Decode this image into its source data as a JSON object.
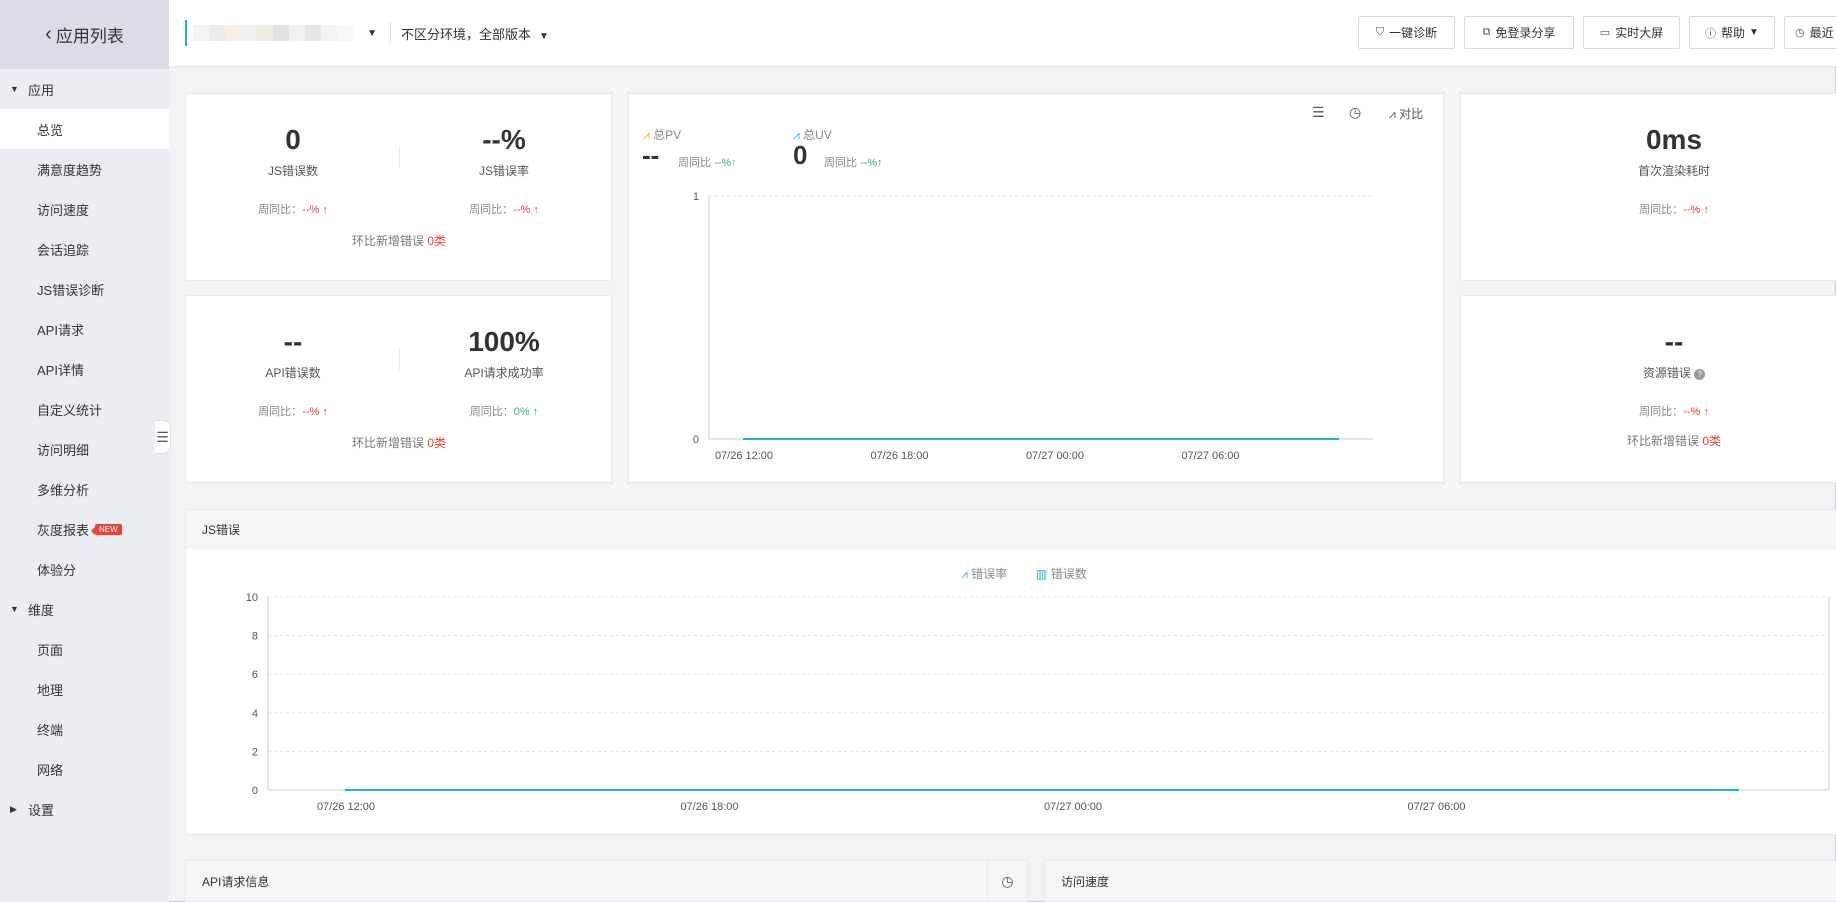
{
  "sidebar": {
    "back_label": "应用列表",
    "groups": [
      {
        "label": "应用",
        "expanded": true,
        "items": [
          "总览",
          "满意度趋势",
          "访问速度",
          "会话追踪",
          "JS错误诊断",
          "API请求",
          "API详情",
          "自定义统计",
          "访问明细",
          "多维分析",
          "灰度报表",
          "体验分"
        ]
      },
      {
        "label": "维度",
        "expanded": true,
        "items": [
          "页面",
          "地理",
          "终端",
          "网络"
        ]
      },
      {
        "label": "设置",
        "expanded": false,
        "items": []
      }
    ],
    "active_item": "总览",
    "new_badge": "NEW"
  },
  "header": {
    "env_label": "不区分环境，全部版本",
    "buttons": {
      "diagnose": "一键诊断",
      "share": "免登录分享",
      "bigscreen": "实时大屏",
      "help": "帮助",
      "recent": "最近"
    }
  },
  "cards": {
    "js_error_count": {
      "value": "0",
      "label": "JS错误数",
      "cmp_label": "周同比：",
      "cmp_value": "--%"
    },
    "js_error_rate": {
      "value": "--%",
      "label": "JS错误率",
      "cmp_label": "周同比：",
      "cmp_value": "--%"
    },
    "js_new_errors": {
      "label": "环比新增错误",
      "value": "0类"
    },
    "api_error_count": {
      "value": "--",
      "label": "API错误数",
      "cmp_label": "周同比：",
      "cmp_value": "--%"
    },
    "api_success_rate": {
      "value": "100%",
      "label": "API请求成功率",
      "cmp_label": "周同比：",
      "cmp_value": "0%"
    },
    "api_new_errors": {
      "label": "环比新增错误",
      "value": "0类"
    },
    "first_render": {
      "value": "0ms",
      "label": "首次渲染耗时",
      "cmp_label": "周同比：",
      "cmp_value": "--%"
    },
    "resource_error": {
      "value": "--",
      "label": "资源错误",
      "cmp_label": "周同比：",
      "cmp_value": "--%",
      "new_label": "环比新增错误",
      "new_value": "0类"
    }
  },
  "pvuv": {
    "pv_label": "总PV",
    "pv_value": "--",
    "pv_cmp_label": "周同比",
    "pv_cmp_value": "--%",
    "uv_label": "总UV",
    "uv_value": "0",
    "uv_cmp_label": "周同比",
    "uv_cmp_value": "--%",
    "compare_label": "对比"
  },
  "js_panel": {
    "title": "JS错误",
    "legend_rate": "错误率",
    "legend_count": "错误数"
  },
  "api_panel": {
    "title": "API请求信息"
  },
  "speed_panel": {
    "title": "访问速度"
  },
  "colors": {
    "accent": "#1fb6c1",
    "red": "#f04134",
    "green": "#2fb87a",
    "pv": "#f5b400",
    "uv": "#3eb3d6"
  },
  "chart_data": [
    {
      "type": "line",
      "x": [
        "07/26 12:00",
        "07/26 18:00",
        "07/27 00:00",
        "07/27 06:00"
      ],
      "y_ticks": [
        "0",
        "1"
      ],
      "ylim": [
        0,
        1
      ],
      "series": [
        {
          "name": "总UV",
          "values": [
            0,
            0,
            0,
            0
          ]
        }
      ],
      "grid": true
    },
    {
      "type": "line",
      "x": [
        "07/26 12:00",
        "07/26 18:00",
        "07/27 00:00",
        "07/27 06:00"
      ],
      "y_ticks": [
        "0",
        "2",
        "4",
        "6",
        "8",
        "10"
      ],
      "y2_ticks": [
        "0",
        "1"
      ],
      "ylim": [
        0,
        10
      ],
      "series": [
        {
          "name": "错误数",
          "values": [
            0,
            0,
            0,
            0
          ]
        }
      ],
      "legend": "top-center",
      "grid": true
    }
  ]
}
